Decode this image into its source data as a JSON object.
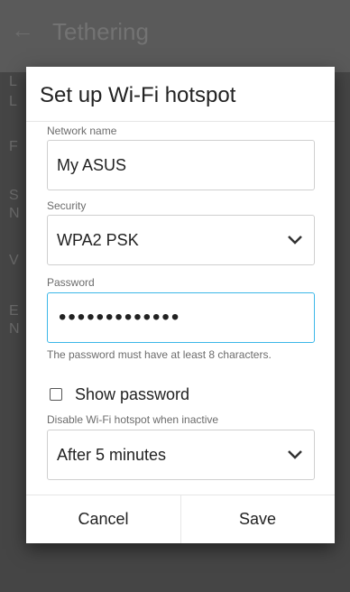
{
  "appbar": {
    "title": "Tethering",
    "back_icon": "arrow-back"
  },
  "dialog": {
    "title": "Set up Wi-Fi hotspot",
    "network_name": {
      "label": "Network name",
      "value": "My ASUS"
    },
    "security": {
      "label": "Security",
      "value": "WPA2 PSK"
    },
    "password": {
      "label": "Password",
      "value_masked": "•••••••••••••",
      "hint": "The password must have at least 8 characters."
    },
    "show_password": {
      "label": "Show password",
      "checked": false
    },
    "disable_when_inactive": {
      "label": "Disable Wi-Fi hotspot when inactive",
      "value": "After 5 minutes"
    },
    "buttons": {
      "cancel": "Cancel",
      "save": "Save"
    }
  },
  "colors": {
    "accent": "#3cb7e8",
    "dialog_bg": "#ffffff",
    "scrim": "#4a4a4a"
  }
}
